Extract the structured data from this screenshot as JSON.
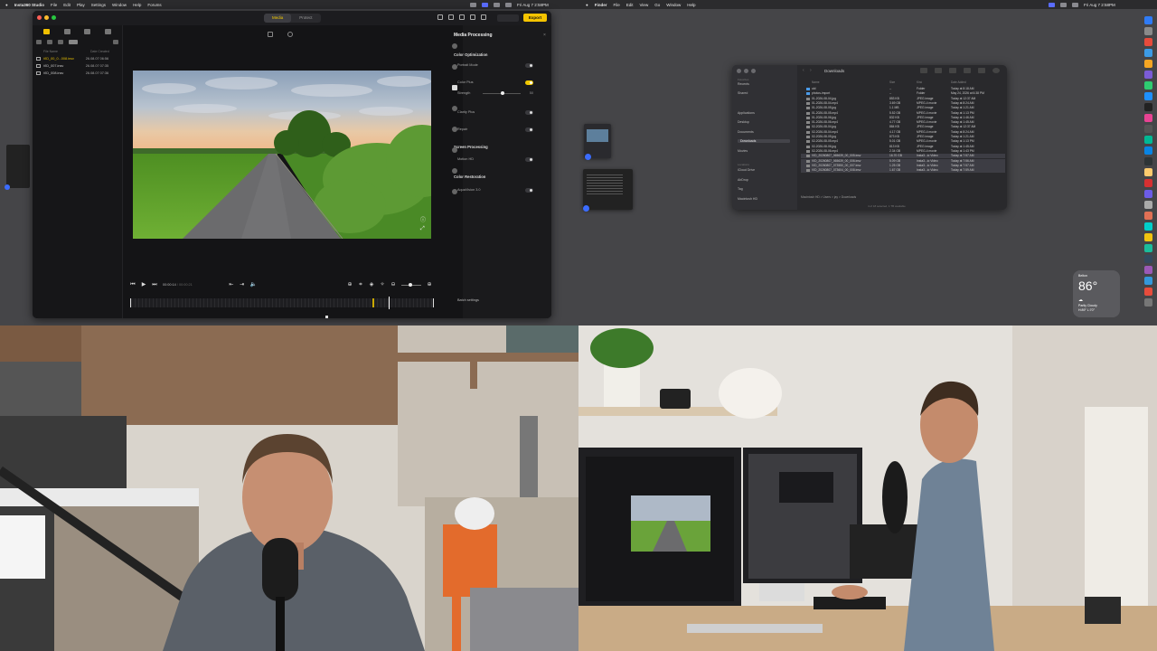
{
  "menubar": {
    "app_name": "Insta360 Studio",
    "items": [
      "File",
      "Edit",
      "Play",
      "Settings",
      "Window",
      "Help",
      "Forums"
    ],
    "clock": "Fri Aug 7 2:58PM",
    "finder_app": "Finder",
    "finder_items": [
      "File",
      "Edit",
      "View",
      "Go",
      "Window",
      "Help"
    ],
    "clock2": "Fri Aug 7 2:58PM"
  },
  "app": {
    "tabs": [
      "Media",
      "Protect"
    ],
    "active_tab": "Media",
    "export_label": "Export",
    "file_columns": [
      "File Name",
      "Date Created"
    ],
    "files": [
      {
        "name": "VID_00_0...008.insv",
        "date": "26.08.07 06:56",
        "selected": true
      },
      {
        "name": "VID_007.insv",
        "date": "26.08.07 07:35",
        "selected": false
      },
      {
        "name": "VID_008.insv",
        "date": "26.08.07 07:36",
        "selected": false
      }
    ],
    "timecode_current": "00:00:14",
    "timecode_total": "/ 00:00:21",
    "panel": {
      "title": "Media Processing",
      "sections": [
        {
          "title": "Color Optimization"
        },
        {
          "title": "Screen Processing"
        },
        {
          "title": "Color Restoration"
        }
      ],
      "rows": {
        "portrait_mode": "Portrait Mode",
        "color_plus": "Color Plus",
        "strength": "Strength",
        "strength_value": "50",
        "clarity_plus": "Clarity Plus",
        "repair": "Repair",
        "motion_hd": "Motion HD",
        "aquavision": "AquaVision 3.0"
      },
      "batch_label": "Batch settings"
    }
  },
  "finder": {
    "title": "Downloads",
    "sidebar": {
      "favorites": [
        "Recents",
        "Shared",
        "Applications",
        "Desktop",
        "Documents",
        "Downloads",
        "Movies"
      ],
      "locations": [
        "iCloud Drive",
        "AirDrop",
        "Tag",
        "Macintosh HD"
      ],
      "cat_favorites": "Favorites",
      "cat_locations": "Locations"
    },
    "columns": [
      "Name",
      "Size",
      "Kind",
      "Date Added"
    ],
    "rows": [
      {
        "name": "old",
        "size": "--",
        "kind": "Folder",
        "date": "Today at 8:18 AM"
      },
      {
        "name": "photos-import",
        "size": "--",
        "kind": "Folder",
        "date": "May 24, 2026 at 6:38 PM"
      },
      {
        "name": "01-2026-08-04.jpg",
        "size": "853 KB",
        "kind": "JPEG image",
        "date": "Today at 12:37 AM"
      },
      {
        "name": "01-2026-08-04.mp4",
        "size": "3.69 GB",
        "kind": "MPEG-4 movie",
        "date": "Today at 8:24 AM"
      },
      {
        "name": "01-2026-08-05.jpg",
        "size": "1.1 MB",
        "kind": "JPEG image",
        "date": "Today at 1:21 AM"
      },
      {
        "name": "01-2026-08-05.mp4",
        "size": "5.52 GB",
        "kind": "MPEG-4 movie",
        "date": "Today at 1:13 PM"
      },
      {
        "name": "01-2026-08-06.jpg",
        "size": "832 KB",
        "kind": "JPEG image",
        "date": "Today at 1:46 AM"
      },
      {
        "name": "01-2026-08-06.mp4",
        "size": "4.77 GB",
        "kind": "MPEG-4 movie",
        "date": "Today at 1:45 AM"
      },
      {
        "name": "02-2026-08-04.jpg",
        "size": "884 KB",
        "kind": "JPEG image",
        "date": "Today at 12:37 AM"
      },
      {
        "name": "02-2026-08-04.mp4",
        "size": "4.17 GB",
        "kind": "MPEG-4 movie",
        "date": "Today at 8:24 AM"
      },
      {
        "name": "02-2026-08-05.jpg",
        "size": "873 KB",
        "kind": "JPEG image",
        "date": "Today at 1:21 AM"
      },
      {
        "name": "02-2026-08-05.mp4",
        "size": "5.01 GB",
        "kind": "MPEG-4 movie",
        "date": "Today at 1:13 PM"
      },
      {
        "name": "02-2026-08-06.jpg",
        "size": "813 KB",
        "kind": "JPEG image",
        "date": "Today at 1:45 AM"
      },
      {
        "name": "02-2026-08-06.mp4",
        "size": "2.34 GB",
        "kind": "MPEG-4 movie",
        "date": "Today at 1:43 PM"
      },
      {
        "name": "VID_20260807_065639_00_005.insv",
        "size": "16.70 GB",
        "kind": "Insta3...io Video",
        "date": "Today at 7:57 AM"
      },
      {
        "name": "VID_20260807_065639_00_006.insv",
        "size": "5.09 GB",
        "kind": "Insta3...io Video",
        "date": "Today at 7:56 AM"
      },
      {
        "name": "VID_20260807_073550_00_007.insv",
        "size": "1.25 GB",
        "kind": "Insta3...io Video",
        "date": "Today at 7:57 AM"
      },
      {
        "name": "VID_20260807_073604_00_008.insv",
        "size": "1.67 GB",
        "kind": "Insta3...io Video",
        "date": "Today at 7:59 AM"
      }
    ],
    "path": "Macintosh HD > Users > jay > Downloads",
    "status": "4 of 18 selected, 1 TB available"
  },
  "weather": {
    "location": "Belton",
    "temp": "86°",
    "condition": "Partly Cloudy",
    "hilo": "H:89° L:70°"
  },
  "colors": {
    "accent": "#f5c400",
    "window_bg": "#141416",
    "desktop_bg": "#454548"
  }
}
